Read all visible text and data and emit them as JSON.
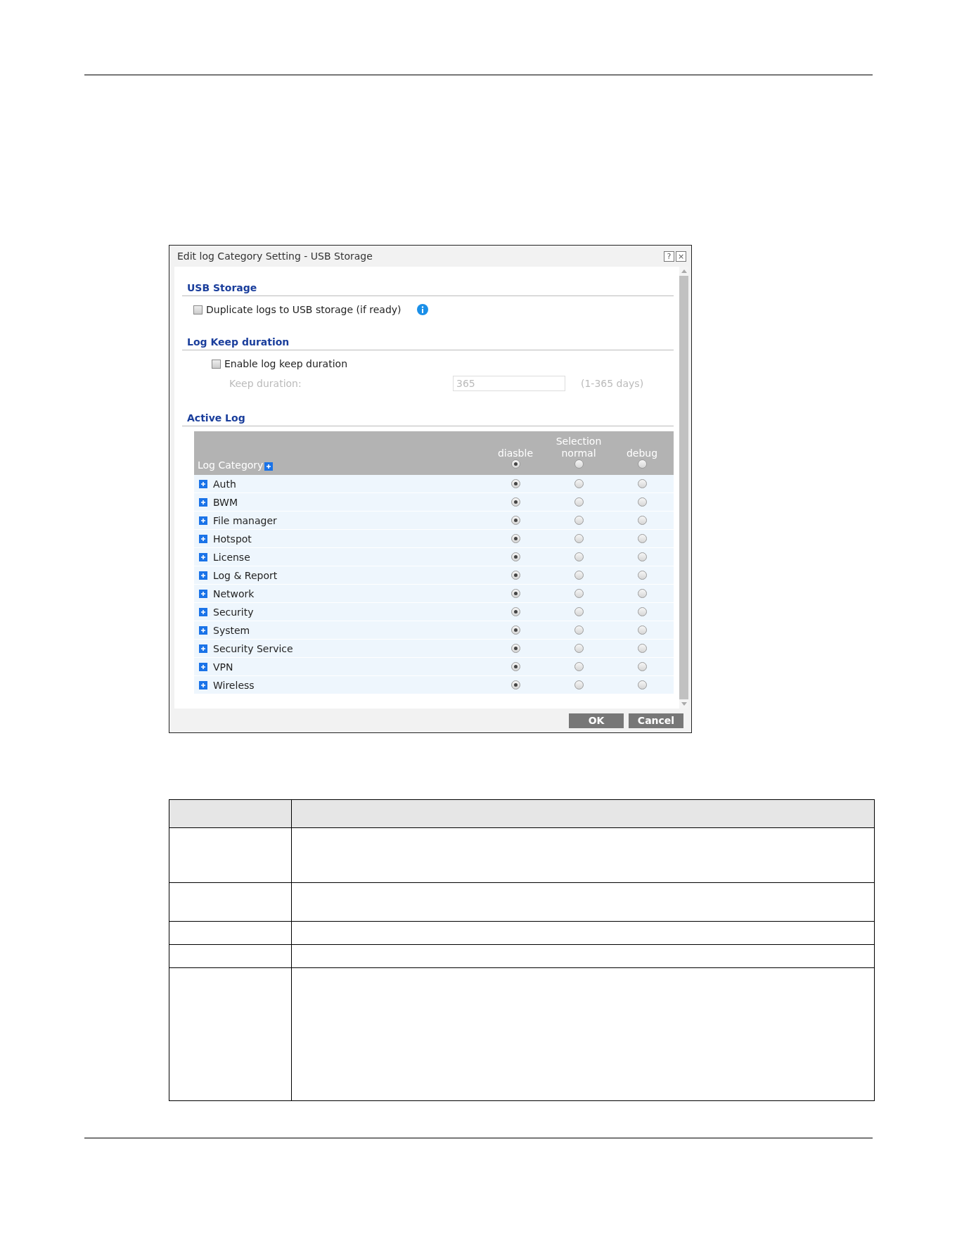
{
  "dialog": {
    "title": "Edit log Category Setting - USB Storage",
    "help_label": "?",
    "close_label": "×",
    "sections": [
      {
        "kind": "usb",
        "heading": "USB Storage",
        "checkbox": {
          "label": "Duplicate logs to USB storage (if ready)",
          "checked": false
        }
      },
      {
        "kind": "keep",
        "heading": "Log Keep duration",
        "checkbox": {
          "label": "Enable log keep duration",
          "checked": false
        },
        "field": {
          "label": "Keep duration:",
          "value": "365",
          "hint": "(1-365 days)",
          "disabled": true
        }
      },
      {
        "kind": "active",
        "heading": "Active Log"
      }
    ],
    "log_table": {
      "group_label": "Selection",
      "category_label": "Log Category",
      "columns": [
        {
          "label": "diasble",
          "selected": true
        },
        {
          "label": "normal",
          "selected": false
        },
        {
          "label": "debug",
          "selected": false
        }
      ],
      "rows": [
        {
          "name": "Auth",
          "levels": [
            {
              "selected": true
            },
            {
              "selected": false
            },
            {
              "selected": false
            }
          ]
        },
        {
          "name": "BWM",
          "levels": [
            {
              "selected": true
            },
            {
              "selected": false
            },
            {
              "selected": false
            }
          ]
        },
        {
          "name": "File manager",
          "levels": [
            {
              "selected": true
            },
            {
              "selected": false
            },
            {
              "selected": false
            }
          ]
        },
        {
          "name": "Hotspot",
          "levels": [
            {
              "selected": true
            },
            {
              "selected": false
            },
            {
              "selected": false
            }
          ]
        },
        {
          "name": "License",
          "levels": [
            {
              "selected": true
            },
            {
              "selected": false
            },
            {
              "selected": false
            }
          ]
        },
        {
          "name": "Log & Report",
          "levels": [
            {
              "selected": true
            },
            {
              "selected": false
            },
            {
              "selected": false
            }
          ]
        },
        {
          "name": "Network",
          "levels": [
            {
              "selected": true
            },
            {
              "selected": false
            },
            {
              "selected": false
            }
          ]
        },
        {
          "name": "Security",
          "levels": [
            {
              "selected": true
            },
            {
              "selected": false
            },
            {
              "selected": false
            }
          ]
        },
        {
          "name": "System",
          "levels": [
            {
              "selected": true
            },
            {
              "selected": false
            },
            {
              "selected": false
            }
          ]
        },
        {
          "name": "Security Service",
          "levels": [
            {
              "selected": true
            },
            {
              "selected": false
            },
            {
              "selected": false
            }
          ]
        },
        {
          "name": "VPN",
          "levels": [
            {
              "selected": true
            },
            {
              "selected": false
            },
            {
              "selected": false
            }
          ]
        },
        {
          "name": "Wireless",
          "levels": [
            {
              "selected": true
            },
            {
              "selected": false
            },
            {
              "selected": false
            }
          ]
        }
      ]
    },
    "buttons": [
      "OK",
      "Cancel"
    ]
  },
  "description_table": {
    "rows": [
      {
        "kind": "header"
      },
      {
        "kind": "tall"
      },
      {
        "kind": "medium"
      },
      {
        "kind": "short"
      },
      {
        "kind": "short"
      },
      {
        "kind": "extra-tall"
      }
    ]
  }
}
